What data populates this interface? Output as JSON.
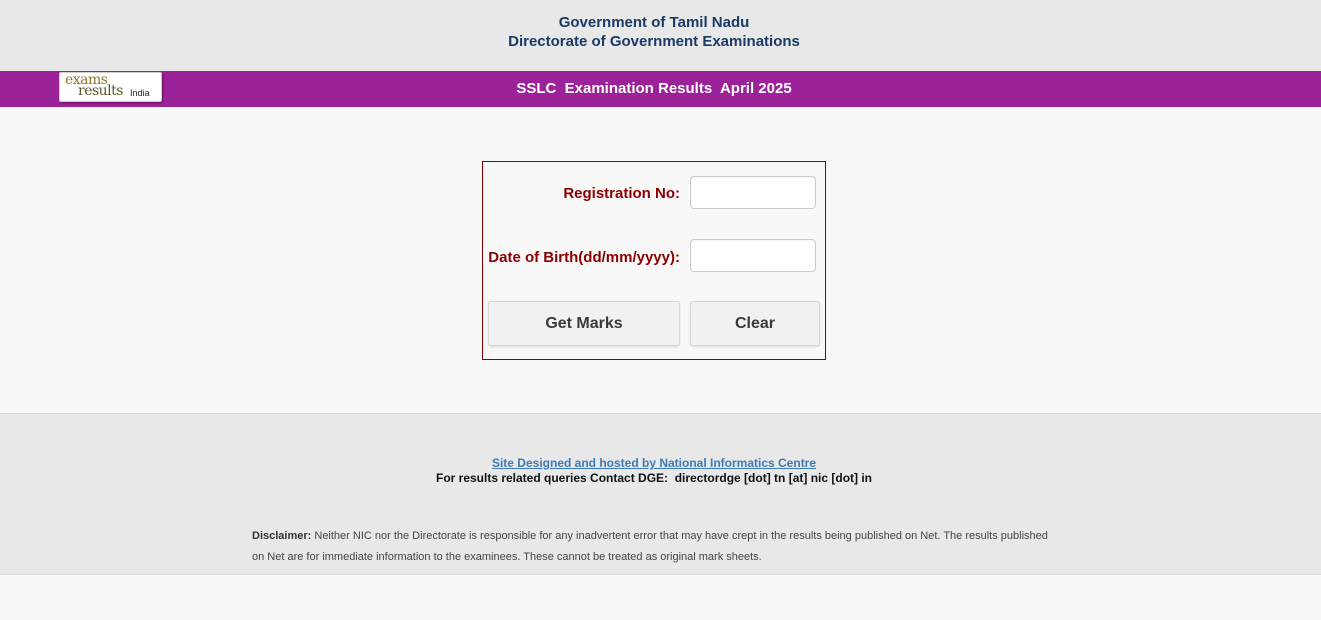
{
  "header": {
    "line1": "Government of Tamil Nadu",
    "line2": "Directorate of Government Examinations"
  },
  "banner": {
    "logo": {
      "word1": "exams",
      "word2": "results",
      "word3": "India"
    },
    "title": "SSLC  Examination Results  April 2025",
    "color": "#9c2299"
  },
  "form": {
    "registration_label": "Registration No:",
    "registration_value": "",
    "dob_label": "Date of Birth(dd/mm/yyyy):",
    "dob_value": "",
    "get_marks_label": "Get Marks",
    "clear_label": "Clear",
    "border_color": "#8b0000"
  },
  "footer": {
    "nic_link": "Site Designed and hosted by National Informatics Centre",
    "contact": "For results related queries Contact DGE:  directordge [dot] tn [at] nic [dot] in",
    "disclaimer_label": "Disclaimer:",
    "disclaimer_text": " Neither NIC nor the Directorate is responsible for any inadvertent error that may have crept in the results being published on Net. The results published on Net are for immediate information to the examinees. These cannot be treated as original mark sheets."
  }
}
